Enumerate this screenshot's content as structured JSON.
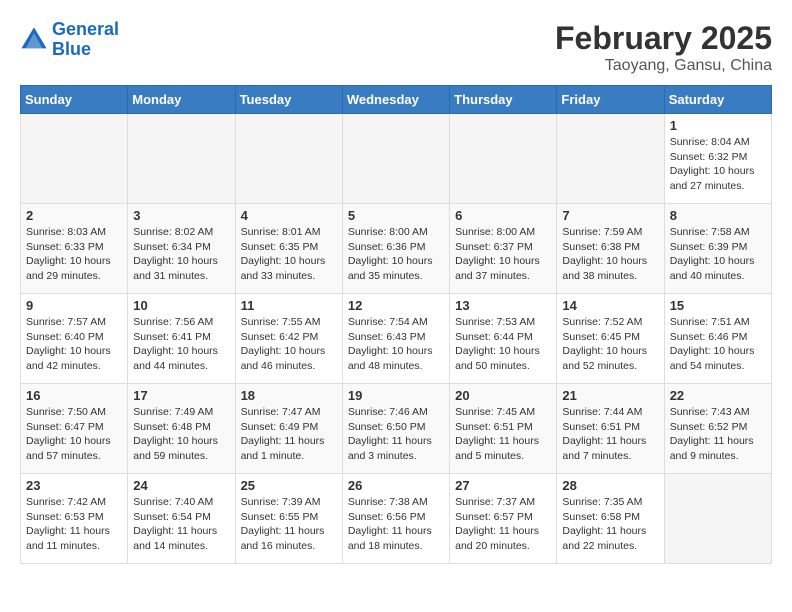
{
  "header": {
    "logo_line1": "General",
    "logo_line2": "Blue",
    "month_year": "February 2025",
    "location": "Taoyang, Gansu, China"
  },
  "days_of_week": [
    "Sunday",
    "Monday",
    "Tuesday",
    "Wednesday",
    "Thursday",
    "Friday",
    "Saturday"
  ],
  "weeks": [
    [
      {
        "day": "",
        "info": ""
      },
      {
        "day": "",
        "info": ""
      },
      {
        "day": "",
        "info": ""
      },
      {
        "day": "",
        "info": ""
      },
      {
        "day": "",
        "info": ""
      },
      {
        "day": "",
        "info": ""
      },
      {
        "day": "1",
        "info": "Sunrise: 8:04 AM\nSunset: 6:32 PM\nDaylight: 10 hours and 27 minutes."
      }
    ],
    [
      {
        "day": "2",
        "info": "Sunrise: 8:03 AM\nSunset: 6:33 PM\nDaylight: 10 hours and 29 minutes."
      },
      {
        "day": "3",
        "info": "Sunrise: 8:02 AM\nSunset: 6:34 PM\nDaylight: 10 hours and 31 minutes."
      },
      {
        "day": "4",
        "info": "Sunrise: 8:01 AM\nSunset: 6:35 PM\nDaylight: 10 hours and 33 minutes."
      },
      {
        "day": "5",
        "info": "Sunrise: 8:00 AM\nSunset: 6:36 PM\nDaylight: 10 hours and 35 minutes."
      },
      {
        "day": "6",
        "info": "Sunrise: 8:00 AM\nSunset: 6:37 PM\nDaylight: 10 hours and 37 minutes."
      },
      {
        "day": "7",
        "info": "Sunrise: 7:59 AM\nSunset: 6:38 PM\nDaylight: 10 hours and 38 minutes."
      },
      {
        "day": "8",
        "info": "Sunrise: 7:58 AM\nSunset: 6:39 PM\nDaylight: 10 hours and 40 minutes."
      }
    ],
    [
      {
        "day": "9",
        "info": "Sunrise: 7:57 AM\nSunset: 6:40 PM\nDaylight: 10 hours and 42 minutes."
      },
      {
        "day": "10",
        "info": "Sunrise: 7:56 AM\nSunset: 6:41 PM\nDaylight: 10 hours and 44 minutes."
      },
      {
        "day": "11",
        "info": "Sunrise: 7:55 AM\nSunset: 6:42 PM\nDaylight: 10 hours and 46 minutes."
      },
      {
        "day": "12",
        "info": "Sunrise: 7:54 AM\nSunset: 6:43 PM\nDaylight: 10 hours and 48 minutes."
      },
      {
        "day": "13",
        "info": "Sunrise: 7:53 AM\nSunset: 6:44 PM\nDaylight: 10 hours and 50 minutes."
      },
      {
        "day": "14",
        "info": "Sunrise: 7:52 AM\nSunset: 6:45 PM\nDaylight: 10 hours and 52 minutes."
      },
      {
        "day": "15",
        "info": "Sunrise: 7:51 AM\nSunset: 6:46 PM\nDaylight: 10 hours and 54 minutes."
      }
    ],
    [
      {
        "day": "16",
        "info": "Sunrise: 7:50 AM\nSunset: 6:47 PM\nDaylight: 10 hours and 57 minutes."
      },
      {
        "day": "17",
        "info": "Sunrise: 7:49 AM\nSunset: 6:48 PM\nDaylight: 10 hours and 59 minutes."
      },
      {
        "day": "18",
        "info": "Sunrise: 7:47 AM\nSunset: 6:49 PM\nDaylight: 11 hours and 1 minute."
      },
      {
        "day": "19",
        "info": "Sunrise: 7:46 AM\nSunset: 6:50 PM\nDaylight: 11 hours and 3 minutes."
      },
      {
        "day": "20",
        "info": "Sunrise: 7:45 AM\nSunset: 6:51 PM\nDaylight: 11 hours and 5 minutes."
      },
      {
        "day": "21",
        "info": "Sunrise: 7:44 AM\nSunset: 6:51 PM\nDaylight: 11 hours and 7 minutes."
      },
      {
        "day": "22",
        "info": "Sunrise: 7:43 AM\nSunset: 6:52 PM\nDaylight: 11 hours and 9 minutes."
      }
    ],
    [
      {
        "day": "23",
        "info": "Sunrise: 7:42 AM\nSunset: 6:53 PM\nDaylight: 11 hours and 11 minutes."
      },
      {
        "day": "24",
        "info": "Sunrise: 7:40 AM\nSunset: 6:54 PM\nDaylight: 11 hours and 14 minutes."
      },
      {
        "day": "25",
        "info": "Sunrise: 7:39 AM\nSunset: 6:55 PM\nDaylight: 11 hours and 16 minutes."
      },
      {
        "day": "26",
        "info": "Sunrise: 7:38 AM\nSunset: 6:56 PM\nDaylight: 11 hours and 18 minutes."
      },
      {
        "day": "27",
        "info": "Sunrise: 7:37 AM\nSunset: 6:57 PM\nDaylight: 11 hours and 20 minutes."
      },
      {
        "day": "28",
        "info": "Sunrise: 7:35 AM\nSunset: 6:58 PM\nDaylight: 11 hours and 22 minutes."
      },
      {
        "day": "",
        "info": ""
      }
    ]
  ]
}
